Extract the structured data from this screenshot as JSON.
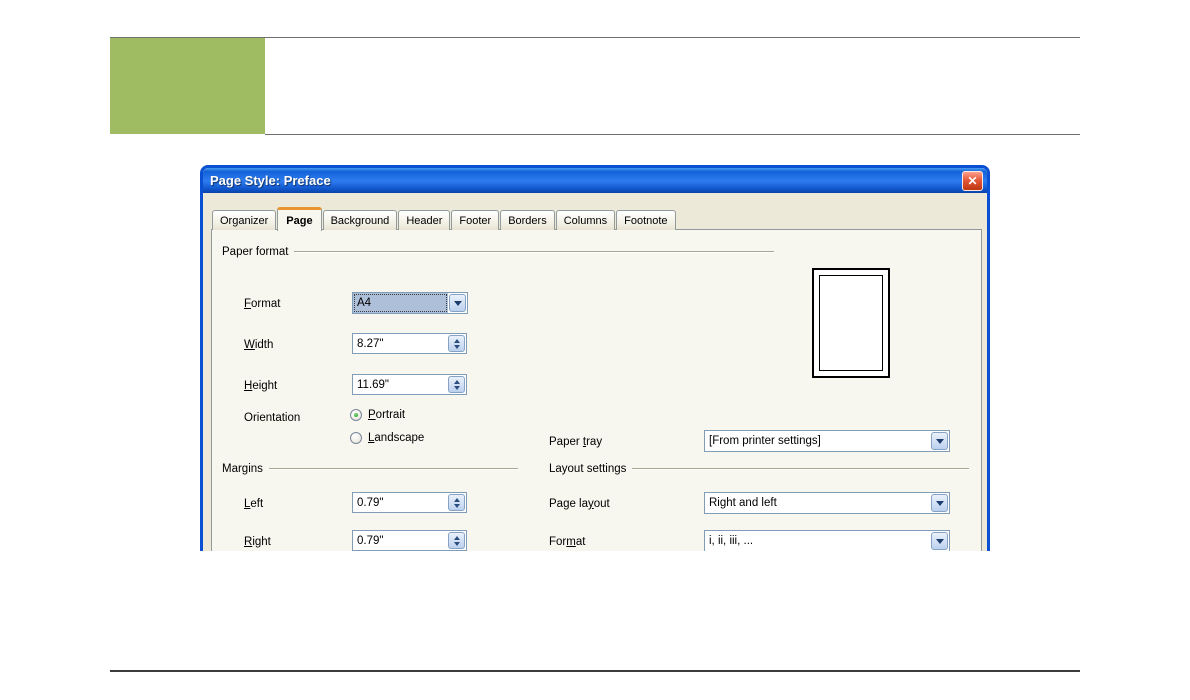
{
  "slide": {
    "accent_color": "#9FBC63"
  },
  "dialog": {
    "title": "Page Style: Preface",
    "close_icon": "✕",
    "active_tab": "Page",
    "tabs": [
      {
        "label": "Organizer"
      },
      {
        "label": "Page"
      },
      {
        "label": "Background"
      },
      {
        "label": "Header"
      },
      {
        "label": "Footer"
      },
      {
        "label": "Borders"
      },
      {
        "label": "Columns"
      },
      {
        "label": "Footnote"
      }
    ],
    "paper_format": {
      "group_label": "Paper format",
      "format": {
        "pre": "",
        "key": "F",
        "post": "ormat",
        "value": "A4"
      },
      "width": {
        "pre": "",
        "key": "W",
        "post": "idth",
        "value": "8.27\""
      },
      "height": {
        "pre": "",
        "key": "H",
        "post": "eight",
        "value": "11.69\""
      },
      "orientation_label": "Orientation",
      "portrait": {
        "pre": "",
        "key": "P",
        "post": "ortrait",
        "selected": true
      },
      "landscape": {
        "pre": "",
        "key": "L",
        "post": "andscape",
        "selected": false
      },
      "paper_tray": {
        "pre": "Paper ",
        "key": "t",
        "post": "ray",
        "value": "[From printer settings]"
      }
    },
    "margins": {
      "group_label": "Margins",
      "left": {
        "pre": "",
        "key": "L",
        "post": "eft",
        "value": "0.79\""
      },
      "right": {
        "pre": "",
        "key": "R",
        "post": "ight",
        "value": "0.79\""
      }
    },
    "layout_settings": {
      "group_label": "Layout settings",
      "page_layout": {
        "pre": "Page la",
        "key": "y",
        "post": "out",
        "value": "Right and left"
      },
      "format": {
        "pre": "For",
        "key": "m",
        "post": "at",
        "value": "i, ii, iii, ..."
      }
    }
  }
}
